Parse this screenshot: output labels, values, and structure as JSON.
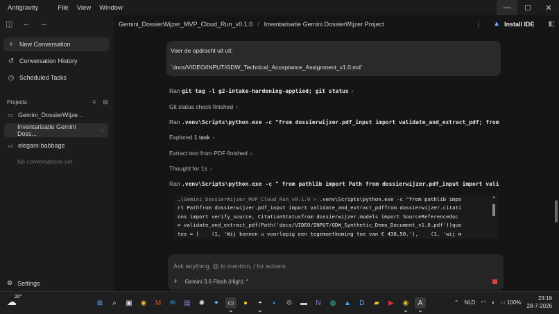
{
  "menu": [
    "Antigravity",
    "File",
    "View",
    "Window"
  ],
  "window_controls": {
    "minimize": "—",
    "maximize": "☐",
    "close": "✕"
  },
  "sidebar": {
    "nav": [
      {
        "label": "New Conversation",
        "icon": "plus-icon"
      },
      {
        "label": "Conversation History",
        "icon": "history-icon"
      },
      {
        "label": "Scheduled Tasks",
        "icon": "clock-icon"
      }
    ],
    "projects_header": "Projects",
    "projects": [
      {
        "label": "Gemini_DossierWijze...",
        "icon": "folder-icon"
      },
      {
        "label": "Inventarisatie Gemini Doss...",
        "active": true
      },
      {
        "label": "elegant-babbage",
        "icon": "folder-icon"
      }
    ],
    "no_conversations": "No conversations yet",
    "settings": "Settings"
  },
  "header": {
    "crumb1": "Gemini_DossierWijzer_MVP_Cloud_Run_v0.1.0",
    "separator": "/",
    "crumb2": "Inventarisatie Gemini DossierWijzer Project",
    "install": "Install IDE"
  },
  "user_message": {
    "line1": "Voer de opdracht uit uit:",
    "line2": "`docs/VIDEO/INPUT/GDW_Technical_Acceptance_Assignment_v1.0.md`"
  },
  "steps": [
    {
      "prefix": "Ran ",
      "code": "git tag -l g2-intake-hardening-applied; git status",
      "suffix": "",
      "chev": "›"
    },
    {
      "prefix": "Git status check finished",
      "code": "",
      "suffix": "",
      "chev": "›"
    },
    {
      "prefix": "Ran ",
      "code": ".venv\\Scripts\\python.exe -c \"from dossierwijzer.pdf_input import validate_and_extract_pdf; from pat",
      "suffix": "",
      "chev": "›"
    },
    {
      "prefix": "Explored ",
      "code": "",
      "suffix": "1 task",
      "chev": "›"
    },
    {
      "prefix": "Extract text from PDF finished",
      "code": "",
      "suffix": "",
      "chev": "›"
    },
    {
      "prefix": "Thought for 1s",
      "code": "",
      "suffix": "",
      "chev": "›"
    },
    {
      "prefix": "Ran ",
      "code": ".venv\\Scripts\\python.exe -c \" from pathlib import Path from dossierwijzer.pdf_input import validate",
      "suffix": "",
      "chev": "⌄"
    }
  ],
  "terminal": {
    "prompt": "…\\Gemini_DossierWijzer_MVP_Cloud_Run_v0.1.0 > ",
    "lines": [
      ".venv\\Scripts\\python.exe -c \"from pathlib impo",
      "rt Pathfrom dossierwijzer.pdf_input import validate_and_extract_pdffrom dossierwijzer.citati",
      "ons import verify_source, CitationStatusfrom dossierwijzer.models import SourceReferencedoc",
      "= validate_and_extract_pdf(Path('docs/VIDEO/INPUT/GDW_Synthetic_Demo_Document_v1.0.pdf'))quo",
      "tes = [    (1, 'Wij kennen u voorlopig een tegemoetkoming toe van € 438,50.'),    (1, 'wij m"
    ]
  },
  "input": {
    "placeholder": "Ask anything, @ to mention, / for actions",
    "model": "Gemini 3.6 Flash (High)"
  },
  "taskbar": {
    "temperature": "20°",
    "language": "NLD",
    "battery": "100%",
    "time": "23:19",
    "date": "28-7-2026",
    "apps": [
      "windows-start-icon",
      "search-icon",
      "task-view-icon",
      "chrome-icon",
      "gmail-icon",
      "outlook-icon",
      "teams-icon",
      "chatgpt-icon",
      "gemini-icon",
      "terminal-icon",
      "keep-icon",
      "github-icon",
      "photos-icon",
      "settings-icon",
      "cmd-icon",
      "visual-studio-icon",
      "edge-icon",
      "photos-app-icon",
      "dictionary-icon",
      "explorer-icon",
      "youtube-icon",
      "chrome-canary-icon",
      "antigravity-icon"
    ]
  },
  "colors": {
    "accent": "#7ab0ff",
    "stop": "#d64545",
    "sidebar_bg": "#1c1c1c",
    "main_bg": "#151515"
  }
}
